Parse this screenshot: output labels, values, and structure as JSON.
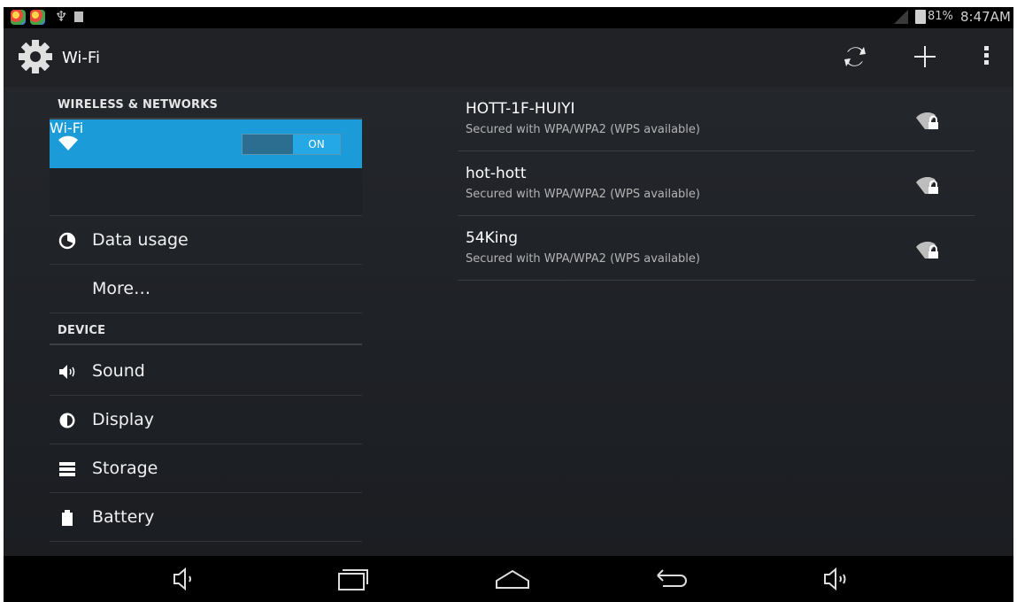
{
  "status_bar": {
    "apps": [
      "app-icon",
      "app-icon"
    ],
    "usb_icon": "usb-icon",
    "battery_percent": "81%",
    "time": "8:47AM"
  },
  "action_bar": {
    "title": "Wi-Fi",
    "icons": [
      "settings-gear-icon",
      "wps-refresh-icon",
      "add-network-icon",
      "overflow-menu-icon"
    ]
  },
  "left_panel": {
    "section_wireless": "WIRELESS & NETWORKS",
    "wifi_label": "Wi-Fi",
    "wifi_toggle_state": "ON",
    "data_usage_label": "Data usage",
    "more_label": "More…",
    "section_device": "DEVICE",
    "sound_label": "Sound",
    "display_label": "Display",
    "storage_label": "Storage",
    "battery_label": "Battery"
  },
  "networks": [
    {
      "ssid": "HOTT-1F-HUIYI",
      "security": "Secured with WPA/WPA2 (WPS available)"
    },
    {
      "ssid": "hot-hott",
      "security": "Secured with WPA/WPA2 (WPS available)"
    },
    {
      "ssid": "54King",
      "security": "Secured with WPA/WPA2 (WPS available)"
    }
  ],
  "nav_bar": {
    "icons": [
      "volume-down-icon",
      "recent-apps-icon",
      "home-icon",
      "back-icon",
      "volume-up-icon"
    ]
  },
  "colors": {
    "accent": "#1b9bd7",
    "background": "#202226",
    "statusbar": "#000000"
  }
}
